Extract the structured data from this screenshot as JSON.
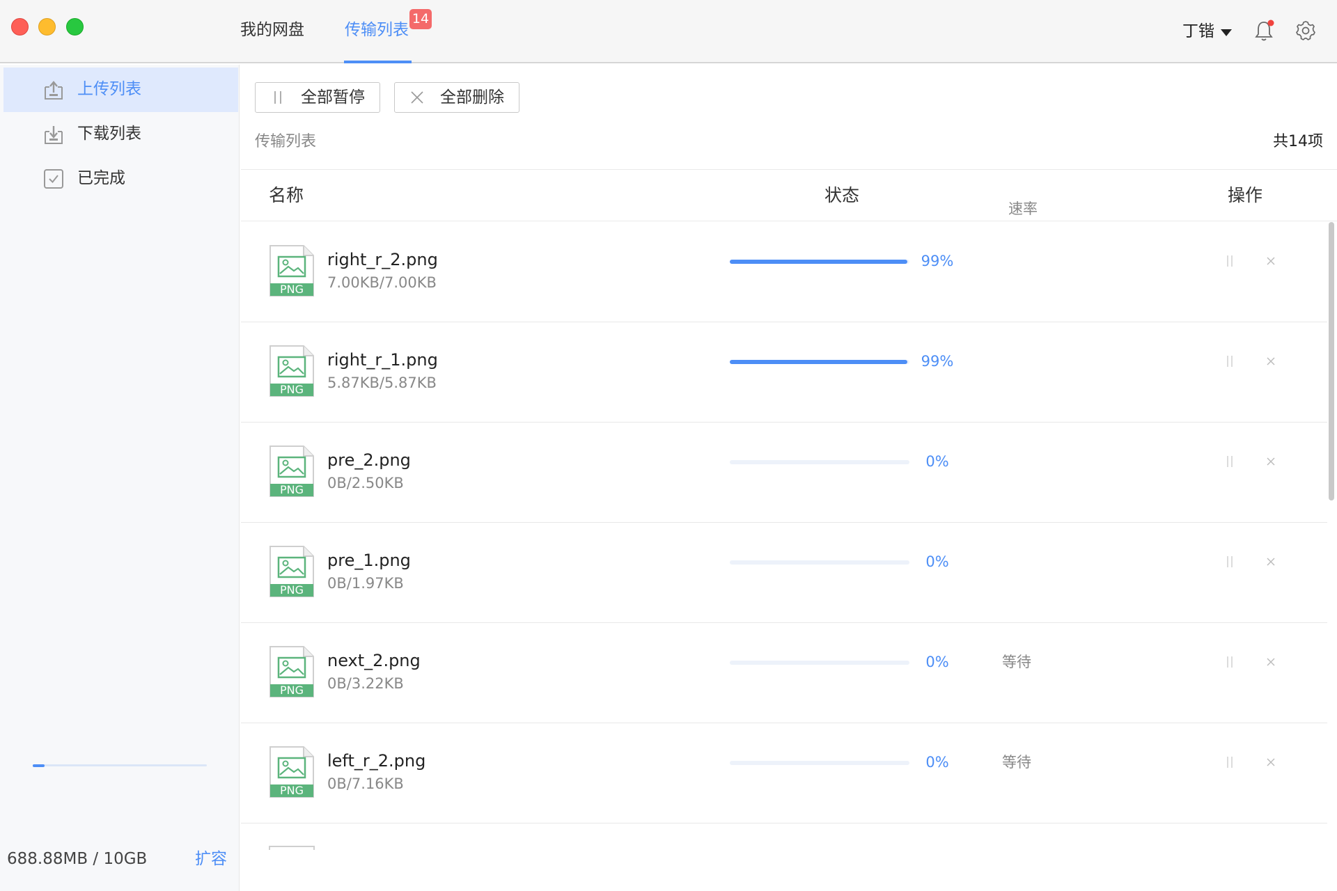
{
  "header": {
    "tabs": [
      {
        "label": "我的网盘"
      },
      {
        "label": "传输列表",
        "badge": "14"
      }
    ],
    "user_name": "丁锴"
  },
  "sidebar": {
    "items": [
      {
        "label": "上传列表",
        "icon": "upload-tray-icon",
        "active": true
      },
      {
        "label": "下载列表",
        "icon": "download-tray-icon",
        "active": false
      },
      {
        "label": "已完成",
        "icon": "check-box-icon",
        "active": false
      }
    ],
    "storage": {
      "text": "688.88MB / 10GB",
      "used_fraction": 0.067,
      "expand_label": "扩容"
    }
  },
  "toolbar": {
    "pause_all_label": "全部暂停",
    "delete_all_label": "全部删除"
  },
  "list": {
    "title": "传输列表",
    "count": "共14项",
    "columns": {
      "name": "名称",
      "status": "状态",
      "speed": "速率",
      "op": "操作"
    },
    "file_type_label": "PNG",
    "rows": [
      {
        "name": "right_r_2.png",
        "size": "7.00KB/7.00KB",
        "progress": 99,
        "percent": "99%",
        "speed": ""
      },
      {
        "name": "right_r_1.png",
        "size": "5.87KB/5.87KB",
        "progress": 99,
        "percent": "99%",
        "speed": ""
      },
      {
        "name": "pre_2.png",
        "size": "0B/2.50KB",
        "progress": 0,
        "percent": "0%",
        "speed": ""
      },
      {
        "name": "pre_1.png",
        "size": "0B/1.97KB",
        "progress": 0,
        "percent": "0%",
        "speed": ""
      },
      {
        "name": "next_2.png",
        "size": "0B/3.22KB",
        "progress": 0,
        "percent": "0%",
        "speed": "等待"
      },
      {
        "name": "left_r_2.png",
        "size": "0B/7.16KB",
        "progress": 0,
        "percent": "0%",
        "speed": "等待"
      }
    ]
  },
  "colors": {
    "accent": "#4d8ef6",
    "badge": "#f46a6a",
    "file_green": "#5bb47c"
  }
}
